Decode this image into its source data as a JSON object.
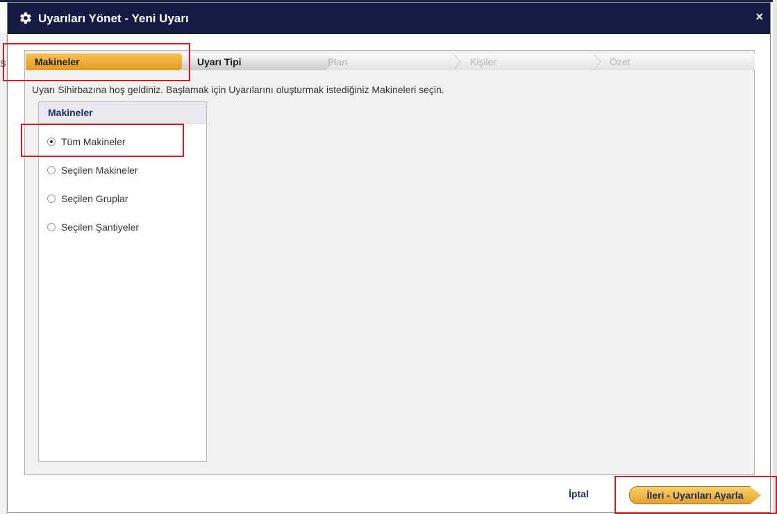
{
  "window": {
    "title": "Uyarıları Yönet - Yeni Uyarı",
    "close_symbol": "×",
    "background_letter": "S"
  },
  "wizard": {
    "steps": [
      {
        "label": "Makineler",
        "state": "active"
      },
      {
        "label": "Uyarı Tipi",
        "state": "next"
      },
      {
        "label": "Plan",
        "state": "disabled"
      },
      {
        "label": "Kişiler",
        "state": "disabled"
      },
      {
        "label": "Özet",
        "state": "disabled"
      }
    ],
    "intro_text": "Uyarı Sihirbazına hoş geldiniz. Başlamak için Uyarılarını oluşturmak istediğiniz Makineleri seçin."
  },
  "machines_panel": {
    "header": "Makineler",
    "options": [
      {
        "label": "Tüm Makineler",
        "selected": true
      },
      {
        "label": "Seçilen Makineler",
        "selected": false
      },
      {
        "label": "Seçilen Gruplar",
        "selected": false
      },
      {
        "label": "Seçilen Şantiyeler",
        "selected": false
      }
    ]
  },
  "footer": {
    "cancel_label": "İptal",
    "next_label": "İleri - Uyarıları Ayarla"
  },
  "colors": {
    "titlebar": "#141c45",
    "accent": "#e49b1e",
    "highlight": "#e0151b",
    "link": "#1b2b58"
  },
  "icons": {
    "title_icon": "gear-icon",
    "close_icon": "close-icon",
    "radio_icon": "radio-button-icon"
  }
}
